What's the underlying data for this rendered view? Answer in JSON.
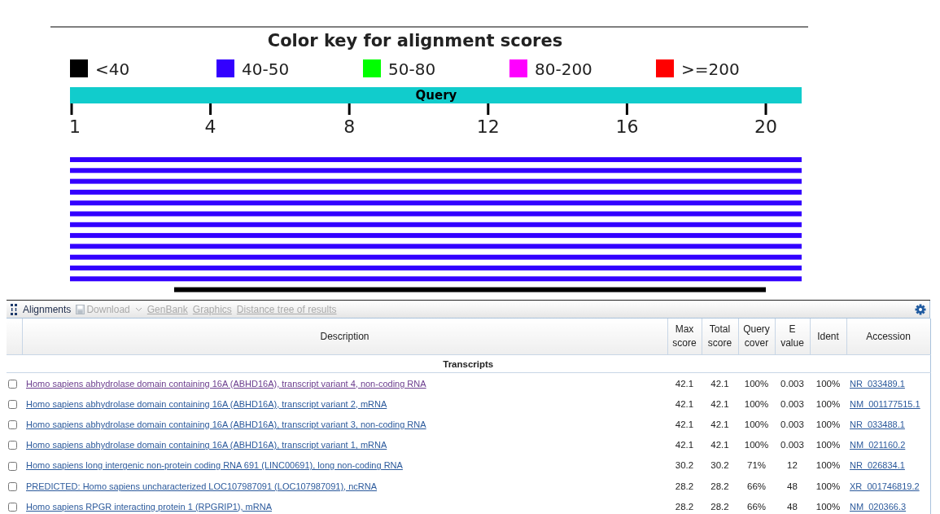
{
  "graphic": {
    "title": "Color key for alignment scores",
    "legend": [
      {
        "label": "<40",
        "color": "#000000"
      },
      {
        "label": "40-50",
        "color": "#3300ff"
      },
      {
        "label": "50-80",
        "color": "#00ff00"
      },
      {
        "label": "80-200",
        "color": "#ff00ff"
      },
      {
        "label": ">=200",
        "color": "#ff0000"
      }
    ],
    "query_label": "Query",
    "ticks": [
      "1",
      "4",
      "8",
      "12",
      "16",
      "20"
    ],
    "hits": [
      {
        "kind": "full",
        "color": "#3300ff"
      },
      {
        "kind": "full",
        "color": "#3300ff"
      },
      {
        "kind": "full",
        "color": "#3300ff"
      },
      {
        "kind": "full",
        "color": "#3300ff"
      },
      {
        "kind": "full",
        "color": "#3300ff"
      },
      {
        "kind": "full",
        "color": "#3300ff"
      },
      {
        "kind": "full",
        "color": "#3300ff"
      },
      {
        "kind": "full",
        "color": "#3300ff"
      },
      {
        "kind": "full",
        "color": "#3300ff"
      },
      {
        "kind": "full",
        "color": "#3300ff"
      },
      {
        "kind": "full",
        "color": "#3300ff"
      },
      {
        "kind": "full",
        "color": "#3300ff"
      },
      {
        "kind": "partial",
        "color": "#000000"
      }
    ]
  },
  "toolbar": [
    {
      "label": "Alignments",
      "kind": "tab",
      "disabled": false
    },
    {
      "label": "Download",
      "kind": "dropdown",
      "disabled": true
    },
    {
      "label": "GenBank",
      "kind": "link",
      "disabled": true
    },
    {
      "label": "Graphics",
      "kind": "link",
      "disabled": true
    },
    {
      "label": "Distance tree of results",
      "kind": "link",
      "disabled": true
    }
  ],
  "table": {
    "columns": [
      "Description",
      "Max score",
      "Total score",
      "Query cover",
      "E value",
      "Ident",
      "Accession"
    ],
    "group": "Transcripts",
    "rows": [
      {
        "checked": false,
        "visited": true,
        "description": "Homo sapiens abhydrolase domain containing 16A (ABHD16A), transcript variant 4, non-coding RNA",
        "max_score": "42.1",
        "total_score": "42.1",
        "query_cover": "100%",
        "e_value": "0.003",
        "ident": "100%",
        "accession": "NR_033489.1"
      },
      {
        "checked": false,
        "visited": false,
        "description": "Homo sapiens abhydrolase domain containing 16A (ABHD16A), transcript variant 2, mRNA",
        "max_score": "42.1",
        "total_score": "42.1",
        "query_cover": "100%",
        "e_value": "0.003",
        "ident": "100%",
        "accession": "NM_001177515.1"
      },
      {
        "checked": false,
        "visited": false,
        "description": "Homo sapiens abhydrolase domain containing 16A (ABHD16A), transcript variant 3, non-coding RNA",
        "max_score": "42.1",
        "total_score": "42.1",
        "query_cover": "100%",
        "e_value": "0.003",
        "ident": "100%",
        "accession": "NR_033488.1"
      },
      {
        "checked": false,
        "visited": false,
        "description": "Homo sapiens abhydrolase domain containing 16A (ABHD16A), transcript variant 1, mRNA",
        "max_score": "42.1",
        "total_score": "42.1",
        "query_cover": "100%",
        "e_value": "0.003",
        "ident": "100%",
        "accession": "NM_021160.2"
      },
      {
        "checked": false,
        "visited": false,
        "description": "Homo sapiens long intergenic non-protein coding RNA 691 (LINC00691), long non-coding RNA",
        "max_score": "30.2",
        "total_score": "30.2",
        "query_cover": "71%",
        "e_value": "12",
        "ident": "100%",
        "accession": "NR_026834.1"
      },
      {
        "checked": false,
        "visited": false,
        "description": "PREDICTED: Homo sapiens uncharacterized LOC107987091 (LOC107987091), ncRNA",
        "max_score": "28.2",
        "total_score": "28.2",
        "query_cover": "66%",
        "e_value": "48",
        "ident": "100%",
        "accession": "XR_001746819.2"
      },
      {
        "checked": false,
        "visited": false,
        "description": "Homo sapiens RPGR interacting protein 1 (RPGRIP1), mRNA",
        "max_score": "28.2",
        "total_score": "28.2",
        "query_cover": "66%",
        "e_value": "48",
        "ident": "100%",
        "accession": "NM_020366.3"
      }
    ]
  }
}
